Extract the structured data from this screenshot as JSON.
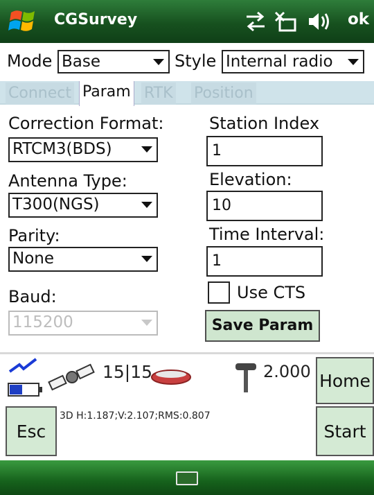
{
  "titlebar": {
    "app_title": "CGSurvey",
    "ok_label": "ok",
    "icons": [
      "windows-start-icon",
      "connectivity-icon",
      "sync-icon",
      "volume-icon"
    ]
  },
  "mode": {
    "label": "Mode",
    "value": "Base"
  },
  "style": {
    "label": "Style",
    "value": "Internal radio"
  },
  "tabs": [
    {
      "label": "Connect",
      "active": false
    },
    {
      "label": "Param",
      "active": true
    },
    {
      "label": "RTK",
      "active": false
    },
    {
      "label": "Position",
      "active": false
    }
  ],
  "params": {
    "correction_format": {
      "label": "Correction Format:",
      "value": "RTCM3(BDS)"
    },
    "antenna_type": {
      "label": "Antenna Type:",
      "value": "T300(NGS)"
    },
    "parity": {
      "label": "Parity:",
      "value": "None"
    },
    "baud": {
      "label": "Baud:",
      "value": "115200"
    },
    "station_index": {
      "label": "Station Index",
      "value": "1"
    },
    "elevation": {
      "label": "Elevation:",
      "value": "10"
    },
    "time_interval": {
      "label": "Time Interval:",
      "value": "1"
    },
    "use_cts": {
      "label": "Use CTS",
      "checked": false
    },
    "save_button": "Save Param"
  },
  "status": {
    "satellites": "15|15",
    "antenna_height": "2.000",
    "solution_text": "3D H:1.187;V:2.107;RMS:0.807"
  },
  "buttons": {
    "home": "Home",
    "esc": "Esc",
    "start": "Start"
  },
  "colors": {
    "title_bar": "#17511f",
    "button_fill": "#d4ead4",
    "tab_strip": "#cfe3ea",
    "battery": "#1f3fc4"
  }
}
